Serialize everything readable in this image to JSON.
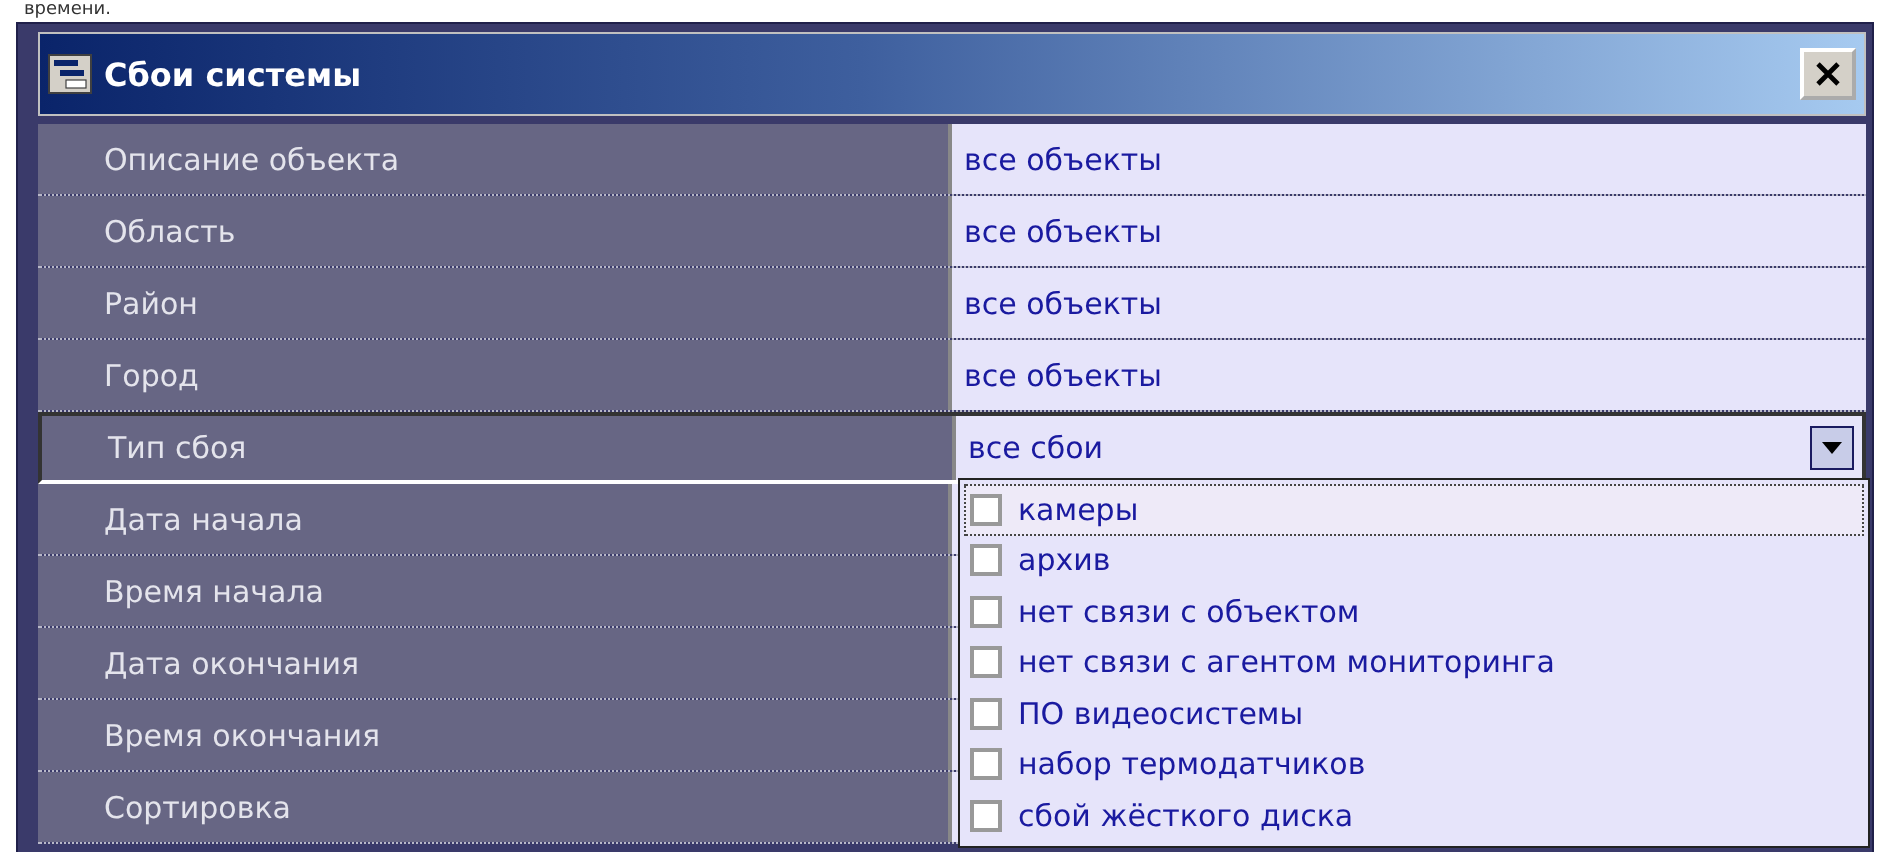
{
  "page_text": "времени.",
  "window": {
    "title": "Сбои системы"
  },
  "rows": [
    {
      "label": "Описание объекта",
      "value": "все объекты",
      "selected": false
    },
    {
      "label": "Область",
      "value": "все объекты",
      "selected": false
    },
    {
      "label": "Район",
      "value": "все объекты",
      "selected": false
    },
    {
      "label": "Город",
      "value": "все объекты",
      "selected": false
    },
    {
      "label": "Тип сбоя",
      "value": "все сбои",
      "selected": true
    },
    {
      "label": "Дата начала",
      "selected": false
    },
    {
      "label": "Время начала",
      "selected": false
    },
    {
      "label": "Дата окончания",
      "selected": false
    },
    {
      "label": "Время окончания",
      "selected": false
    },
    {
      "label": "Сортировка",
      "selected": false
    }
  ],
  "dropdown": {
    "items": [
      {
        "label": "камеры",
        "checked": false,
        "selected": true
      },
      {
        "label": "архив",
        "checked": false,
        "selected": false
      },
      {
        "label": "нет связи с объектом",
        "checked": false,
        "selected": false
      },
      {
        "label": "нет связи с агентом мониторинга",
        "checked": false,
        "selected": false
      },
      {
        "label": "ПО видеосистемы",
        "checked": false,
        "selected": false
      },
      {
        "label": "набор термодатчиков",
        "checked": false,
        "selected": false
      },
      {
        "label": "сбой жёсткого диска",
        "checked": false,
        "selected": false
      }
    ]
  }
}
